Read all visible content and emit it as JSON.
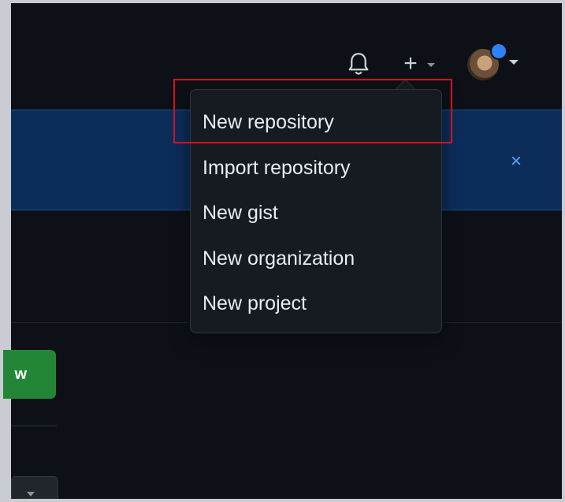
{
  "header": {
    "notification_icon": "bell-icon",
    "create_icon": "plus-icon",
    "avatar_badge_color": "#2f81f7"
  },
  "banner": {
    "close_label": "×",
    "color": "#0c2d5a"
  },
  "create_menu": {
    "items": [
      {
        "label": "New repository"
      },
      {
        "label": "Import repository"
      },
      {
        "label": "New gist"
      },
      {
        "label": "New organization"
      },
      {
        "label": "New project"
      }
    ]
  },
  "left_panel": {
    "new_button_label": "w",
    "new_button_color": "#238636"
  }
}
